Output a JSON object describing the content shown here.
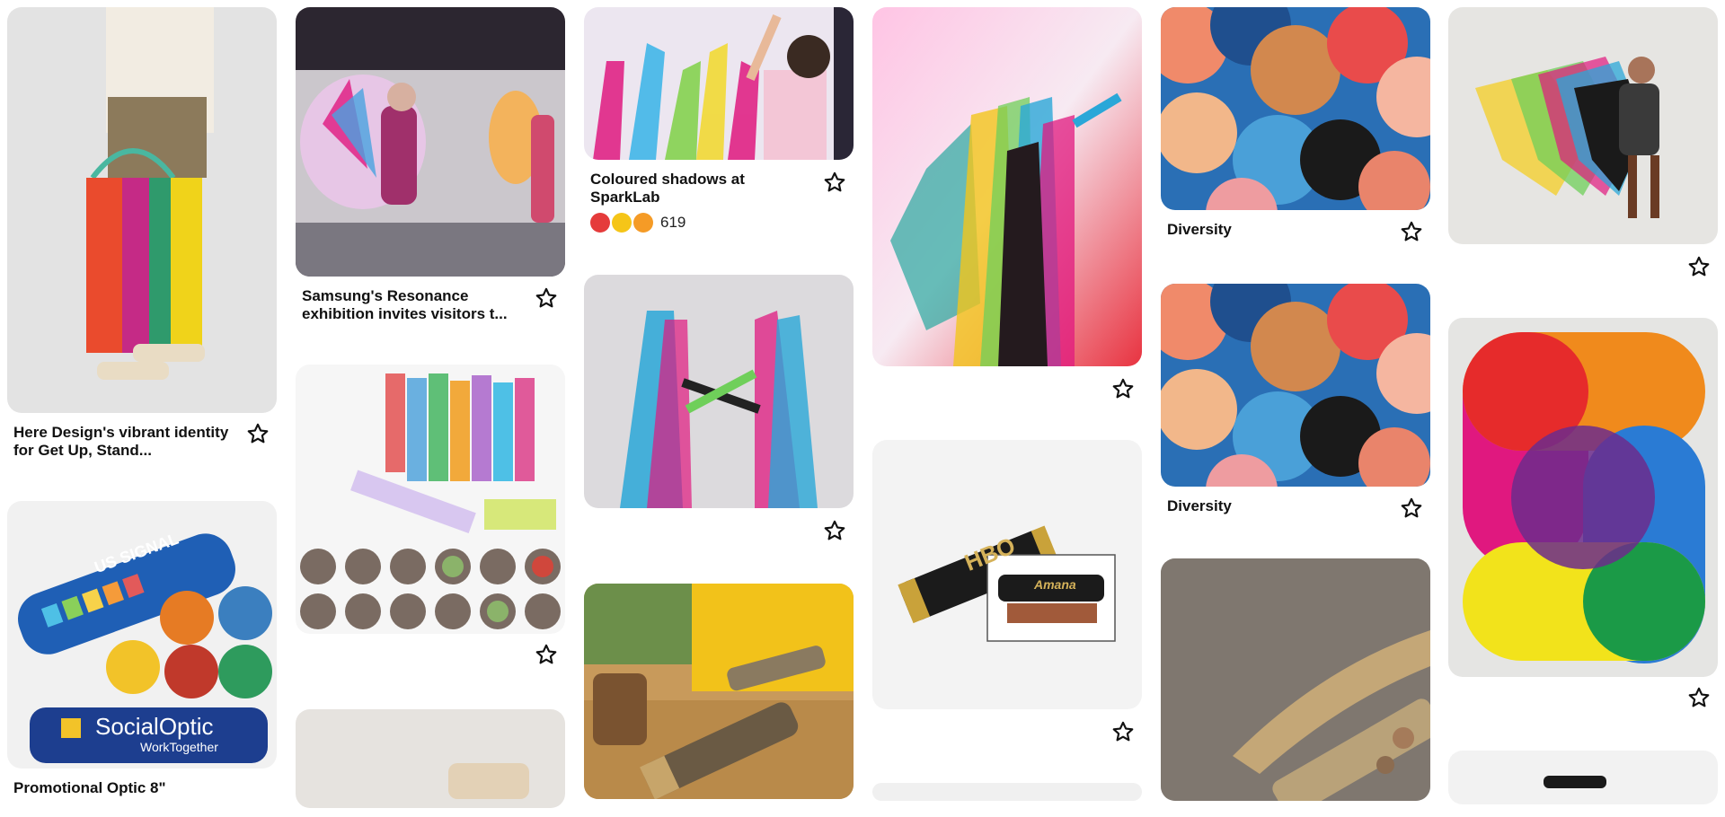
{
  "pins": {
    "c1": [
      {
        "title": "Here Design's vibrant identity for Get Up, Stand...",
        "save_icon": "star-icon"
      },
      {
        "title": "Promotional Optic 8\"",
        "save_icon": "star-icon",
        "image_text": {
          "brand": "US SIGNAL",
          "logo_main": "SocialOptic",
          "logo_sub": "WorkTogether"
        }
      }
    ],
    "c2": [
      {
        "title": "Samsung's Resonance exhibition invites visitors t...",
        "save_icon": "star-icon"
      },
      {
        "title": "",
        "save_icon": "star-icon"
      },
      {
        "title": "",
        "save_icon": "star-icon"
      }
    ],
    "c3": [
      {
        "title": "Coloured shadows at SparkLab",
        "reaction_count": "619",
        "reactions": [
          "heart-eyes",
          "star-struck",
          "wow"
        ],
        "save_icon": "star-icon"
      },
      {
        "title": "",
        "save_icon": "star-icon"
      },
      {
        "title": "",
        "save_icon": "star-icon"
      }
    ],
    "c4": [
      {
        "title": "",
        "save_icon": "star-icon"
      },
      {
        "title": "",
        "save_icon": "star-icon",
        "image_text": {
          "brand": "HBO",
          "inset": "Amana"
        }
      },
      {
        "title": "",
        "save_icon": "star-icon"
      }
    ],
    "c5": [
      {
        "title": "Diversity",
        "save_icon": "star-icon"
      },
      {
        "title": "Diversity",
        "save_icon": "star-icon"
      },
      {
        "title": "",
        "save_icon": "star-icon"
      }
    ],
    "c6": [
      {
        "title": "",
        "save_icon": "star-icon"
      },
      {
        "title": "",
        "save_icon": "star-icon"
      },
      {
        "title": "",
        "save_icon": "star-icon"
      }
    ]
  },
  "colors": {
    "red": "#e62b2b",
    "orange": "#f08a1c",
    "magenta": "#e0187f",
    "blue": "#2a7bd4",
    "yellow": "#f2e31b",
    "green": "#1b9a47",
    "purple": "#6c2c8c"
  }
}
